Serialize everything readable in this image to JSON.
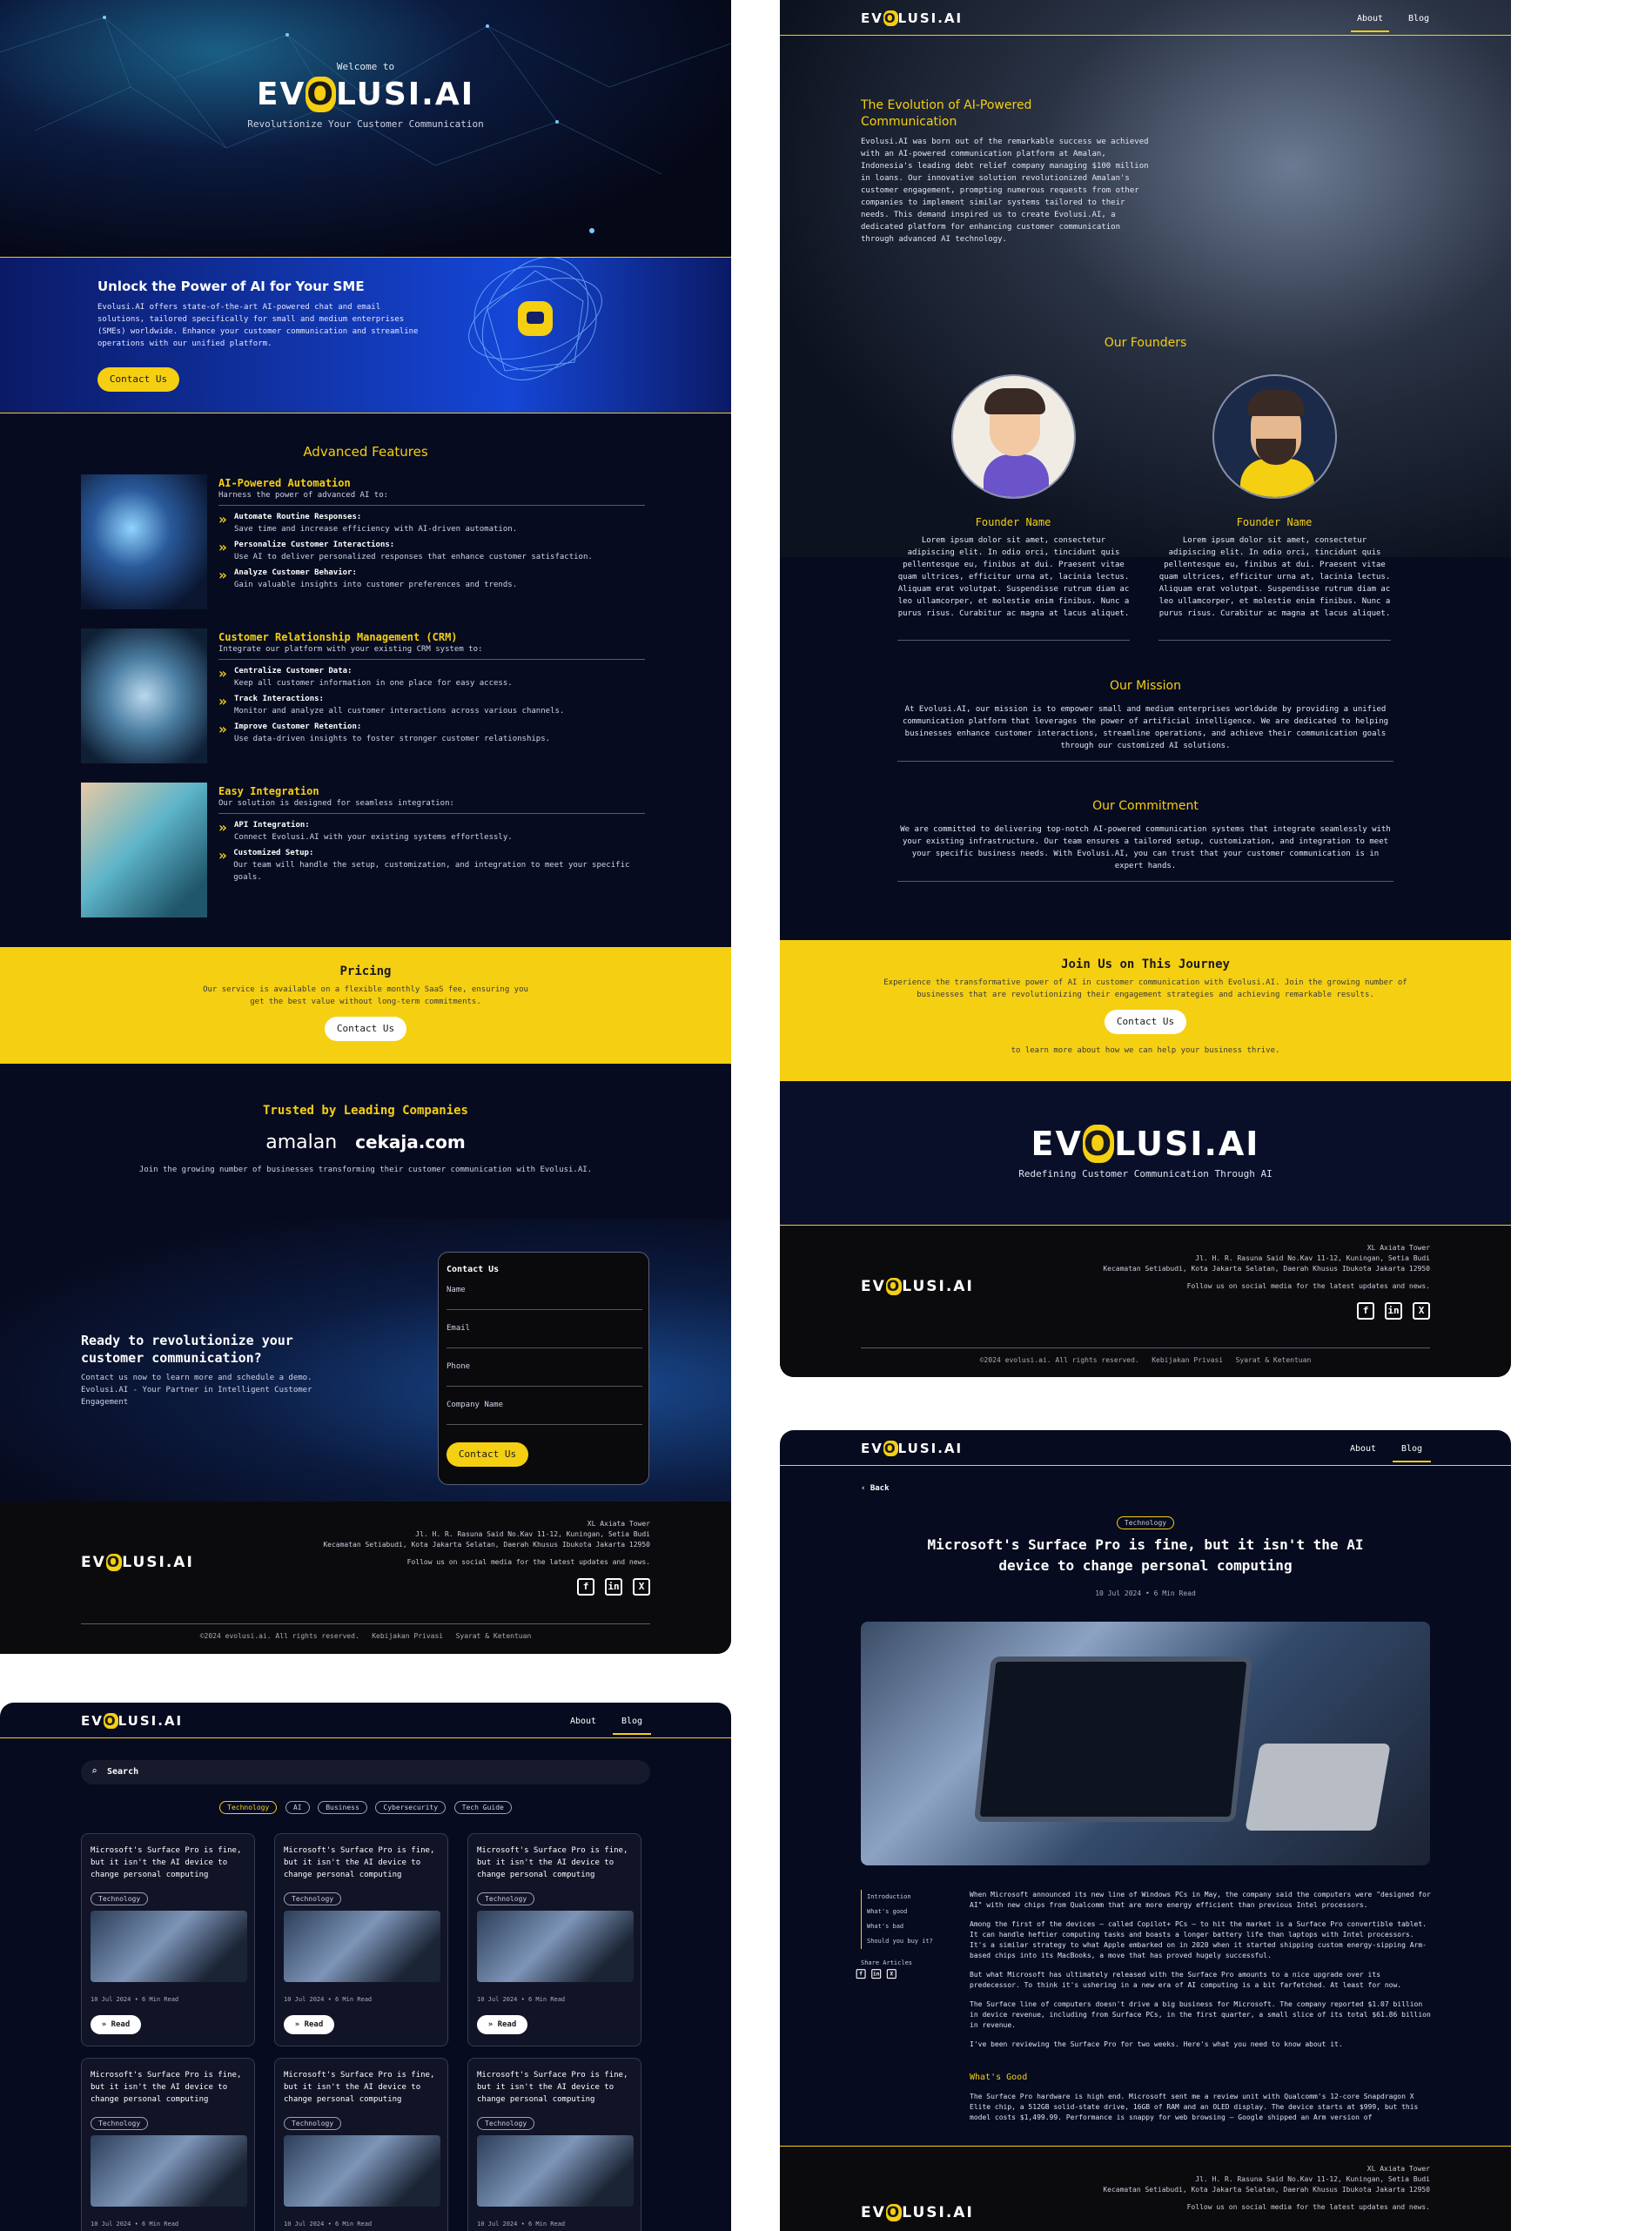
{
  "home": {
    "welcome": "Welcome to",
    "logo": "EVOLUSI.AI",
    "tagline": "Revolutionize Your Customer Communication",
    "unlock_title": "Unlock the Power of AI for Your SME",
    "unlock_text": "Evolusi.AI offers state-of-the-art AI-powered chat and email solutions, tailored specifically for small and medium enterprises (SMEs) worldwide. Enhance your customer communication and streamline operations with our unified platform.",
    "contact_btn": "Contact Us",
    "features_title": "Advanced Features",
    "features": [
      {
        "title": "AI-Powered Automation",
        "sub": "Harness the power of advanced AI to:",
        "items": [
          {
            "h": "Automate Routine Responses:",
            "t": "Save time and increase efficiency with AI-driven automation."
          },
          {
            "h": "Personalize Customer Interactions:",
            "t": "Use AI to deliver personalized responses that enhance customer satisfaction."
          },
          {
            "h": "Analyze Customer Behavior:",
            "t": "Gain valuable insights into customer preferences and trends."
          }
        ]
      },
      {
        "title": "Customer Relationship Management (CRM)",
        "sub": "Integrate our platform with your existing CRM system to:",
        "items": [
          {
            "h": "Centralize Customer Data:",
            "t": "Keep all customer information in one place for easy access."
          },
          {
            "h": "Track Interactions:",
            "t": "Monitor and analyze all customer interactions across various channels."
          },
          {
            "h": "Improve Customer Retention:",
            "t": "Use data-driven insights to foster stronger customer relationships."
          }
        ]
      },
      {
        "title": "Easy Integration",
        "sub": "Our solution is designed for seamless integration:",
        "items": [
          {
            "h": "API Integration:",
            "t": "Connect Evolusi.AI with your existing systems effortlessly."
          },
          {
            "h": "Customized Setup:",
            "t": "Our team will handle the setup, customization, and integration to meet your specific goals."
          }
        ]
      }
    ],
    "pricing_title": "Pricing",
    "pricing_text": "Our service is available on a flexible monthly SaaS fee, ensuring you get the best value without long-term commitments.",
    "trusted_title": "Trusted by Leading Companies",
    "brand1": "amalan",
    "brand2": "cekaja.com",
    "trusted_text": "Join the growing number of businesses transforming their customer communication with Evolusi.AI.",
    "ready_title": "Ready to revolutionize your customer communication?",
    "ready_text": "Contact us now to learn more and schedule a demo. Evolusi.AI - Your Partner in Intelligent Customer Engagement",
    "form": {
      "title": "Contact Us",
      "name": "Name",
      "email": "Email",
      "phone": "Phone",
      "company": "Company Name",
      "submit": "Contact Us"
    }
  },
  "footer": {
    "addr1": "XL Axiata Tower",
    "addr2": "Jl. H. R. Rasuna Said No.Kav 11-12, Kuningan, Setia Budi",
    "addr3": "Kecamatan Setiabudi, Kota Jakarta Selatan, Daerah Khusus Ibukota Jakarta 12950",
    "follow": "Follow us on social media for the latest updates and news.",
    "copyright": "©2024 evolusi.ai. All rights reserved.",
    "privacy": "Kebijakan Privasi",
    "terms": "Syarat & Ketentuan",
    "fb": "f",
    "li": "in",
    "x": "X"
  },
  "nav": {
    "about": "About",
    "blog": "Blog"
  },
  "about": {
    "evo_title": "The Evolution of AI-Powered Communication",
    "evo_text": "Evolusi.AI was born out of the remarkable success we achieved with an AI-powered communication platform at Amalan, Indonesia's leading debt relief company managing $100 million in loans. Our innovative solution revolutionized Amalan's customer engagement, prompting numerous requests from other companies to implement similar systems tailored to their needs. This demand inspired us to create Evolusi.AI, a dedicated platform for enhancing customer communication through advanced AI technology.",
    "founders_title": "Our Founders",
    "founder_name": "Founder Name",
    "founder_bio": "Lorem ipsum dolor sit amet, consectetur adipiscing elit. In odio orci, tincidunt quis pellentesque eu, finibus at dui. Praesent vitae quam ultrices, efficitur urna at, lacinia lectus. Aliquam erat volutpat. Suspendisse rutrum diam ac leo ullamcorper, et molestie enim finibus. Nunc a purus risus. Curabitur ac magna at lacus aliquet.",
    "mission_title": "Our Mission",
    "mission_text": "At Evolusi.AI, our mission is to empower small and medium enterprises worldwide by providing a unified communication platform that leverages the power of artificial intelligence. We are dedicated to helping businesses enhance customer interactions, streamline operations, and achieve their communication goals through our customized AI solutions.",
    "commit_title": "Our Commitment",
    "commit_text": "We are committed to delivering top-notch AI-powered communication systems that integrate seamlessly with your existing infrastructure. Our team ensures a tailored setup, customization, and integration to meet your specific business needs. With Evolusi.AI, you can trust that your customer communication is in expert hands.",
    "join_title": "Join Us on This Journey",
    "join_text": "Experience the transformative power of AI in customer communication with Evolusi.AI. Join the growing number of businesses that are revolutionizing their engagement strategies and achieving remarkable results.",
    "join_btn": "Contact Us",
    "join_after": "to learn more about how we can help your business thrive.",
    "footer_tag": "Redefining Customer Communication Through AI"
  },
  "blog": {
    "search": "Search",
    "tags": [
      "Technology",
      "AI",
      "Business",
      "Cybersecurity",
      "Tech Guide"
    ],
    "card_title": "Microsoft's Surface Pro is fine, but it isn't the AI device to change personal computing",
    "card_tag": "Technology",
    "card_meta": "10 Jul 2024  •  6 Min Read",
    "read": "Read"
  },
  "article": {
    "back": "Back",
    "tag": "Technology",
    "title": "Microsoft's Surface Pro is fine, but it isn't the AI device to change personal computing",
    "meta": "10 Jul 2024  •  6 Min Read",
    "toc": [
      "Introduction",
      "What's good",
      "What's bad",
      "Should you buy it?"
    ],
    "share": "Share Articles",
    "p1": "When Microsoft announced its new line of Windows PCs in May, the company said the computers were \"designed for AI\" with new chips from Qualcomm that are more energy efficient than previous Intel processors.",
    "p2": "Among the first of the devices — called Copilot+ PCs — to hit the market is a Surface Pro convertible tablet. It can handle heftier computing tasks and boasts a longer battery life than laptops with Intel processors. It's a similar strategy to what Apple embarked on in 2020 when it started shipping custom energy-sipping Arm-based chips into its MacBooks, a move that has proved hugely successful.",
    "p3": "But what Microsoft has ultimately released with the Surface Pro amounts to a nice upgrade over its predecessor. To think it's ushering in a new era of AI computing is a bit farfetched. At least for now.",
    "p4": "The Surface line of computers doesn't drive a big business for Microsoft. The company reported $1.07 billion in device revenue, including from Surface PCs, in the first quarter, a small slice of its total $61.86 billion in revenue.",
    "p5": "I've been reviewing the Surface Pro for two weeks. Here's what you need to know about it.",
    "h2": "What's Good",
    "p6": "The Surface Pro hardware is high end. Microsoft sent me a review unit with Qualcomm's 12-core Snapdragon X Elite chip, a 512GB solid-state drive, 16GB of RAM and an OLED display. The device starts at $999, but this model costs $1,499.99. Performance is snappy for web browsing — Google shipped an Arm version of"
  }
}
